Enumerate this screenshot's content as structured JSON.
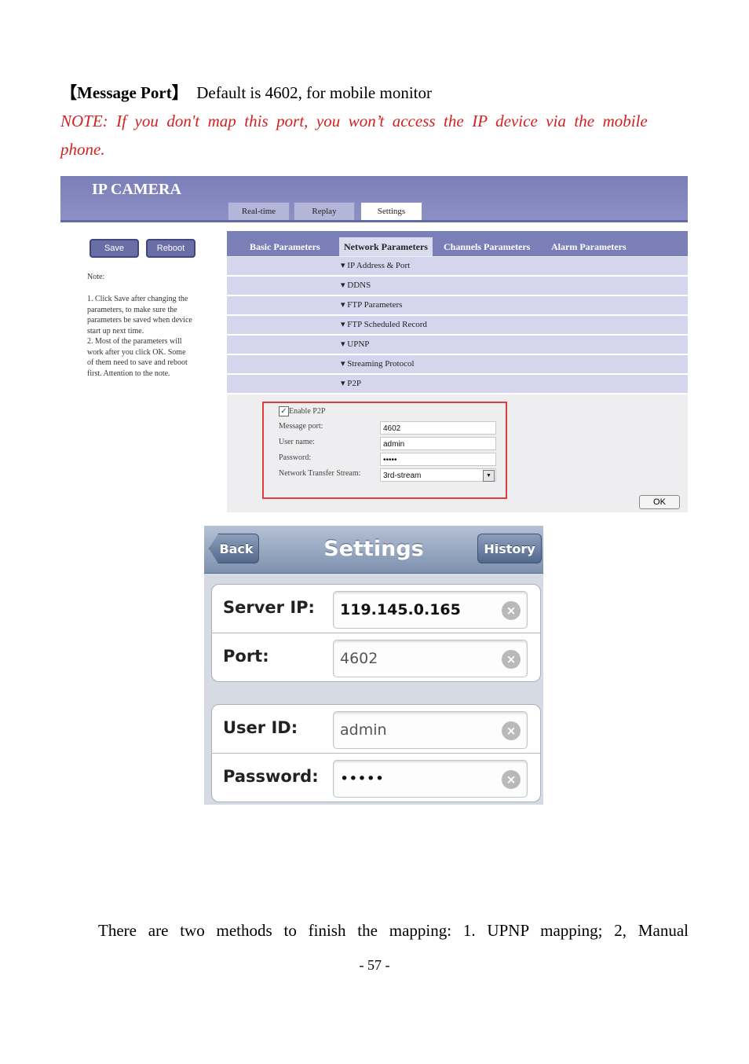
{
  "heading": {
    "bracket_open": "【",
    "term": "Message Port",
    "bracket_close": "】",
    "text": "Default is 4602, for mobile monitor"
  },
  "note_line1": "NOTE:  If  you  don't  map  this  port,  you  won’t  access  the  IP  device  via  the  mobile",
  "note_line2": "phone.",
  "camera_ui": {
    "logo": "IP CAMERA",
    "top_tabs": [
      "Real-time",
      "Replay",
      "Settings"
    ],
    "buttons": {
      "save": "Save",
      "reboot": "Reboot"
    },
    "note_title": "Note:",
    "note_lines": [
      "1. Click Save after changing the",
      "parameters, to make sure the",
      "parameters be saved when device",
      "start up next time.",
      "2. Most of the parameters will",
      "work after you click OK. Some",
      "of them need to save and reboot",
      "first. Attention to the note."
    ],
    "sub_tabs": [
      "Basic Parameters",
      "Network Parameters",
      "Channels Parameters",
      "Alarm Parameters"
    ],
    "sections": [
      "IP Address & Port",
      "DDNS",
      "FTP Parameters",
      "FTP Scheduled Record",
      "UPNP",
      "Streaming Protocol",
      "P2P"
    ],
    "p2p": {
      "enable_label": "Enable P2P",
      "message_port_label": "Message port:",
      "message_port_value": "4602",
      "user_name_label": "User name:",
      "user_name_value": "admin",
      "password_label": "Password:",
      "password_value": "•••••",
      "stream_label": "Network Transfer Stream:",
      "stream_value": "3rd-stream"
    },
    "ok_label": "OK"
  },
  "phone_ui": {
    "back_label": "Back",
    "title": "Settings",
    "history_label": "History",
    "server_ip_label": "Server IP:",
    "server_ip_value": "119.145.0.165",
    "port_label": "Port:",
    "port_value": "4602",
    "user_id_label": "User ID:",
    "user_id_value": "admin",
    "password_label": "Password:",
    "password_value": "•••••"
  },
  "body_text": "There are two methods to finish the mapping: 1. UPNP mapping; 2, Manual",
  "page_number": "- 57 -"
}
